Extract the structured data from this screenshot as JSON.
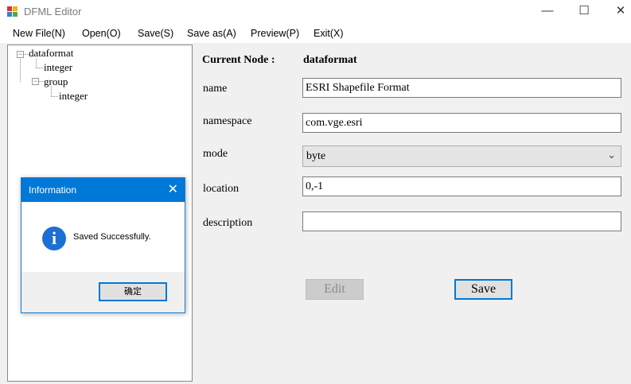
{
  "window": {
    "title": "DFML Editor",
    "minimize_glyph": "—",
    "maximize_glyph": "☐",
    "close_glyph": "✕"
  },
  "menu": {
    "items": [
      "New File(N)",
      "Open(O)",
      "Save(S)",
      "Save as(A)",
      "Preview(P)",
      "Exit(X)"
    ]
  },
  "tree": {
    "nodes": [
      {
        "label": "dataformat",
        "expander": "−"
      },
      {
        "label": "integer"
      },
      {
        "label": "group",
        "expander": "−"
      },
      {
        "label": "integer"
      }
    ]
  },
  "form": {
    "current_node_label": "Current Node :",
    "current_node_value": "dataformat",
    "name_label": "name",
    "name_value": "ESRI Shapefile Format",
    "namespace_label": "namespace",
    "namespace_value": "com.vge.esri",
    "mode_label": "mode",
    "mode_value": "byte",
    "location_label": "location",
    "location_value": "0,-1",
    "description_label": "description",
    "description_value": "",
    "edit_button": "Edit",
    "save_button": "Save"
  },
  "dialog": {
    "title": "Information",
    "close_glyph": "✕",
    "icon_glyph": "i",
    "message": "Saved Successfully.",
    "ok_button": "确定"
  },
  "icons": {
    "app": "dfml-app-icon",
    "info": "info-icon",
    "dropdown": "chevron-down-icon"
  }
}
